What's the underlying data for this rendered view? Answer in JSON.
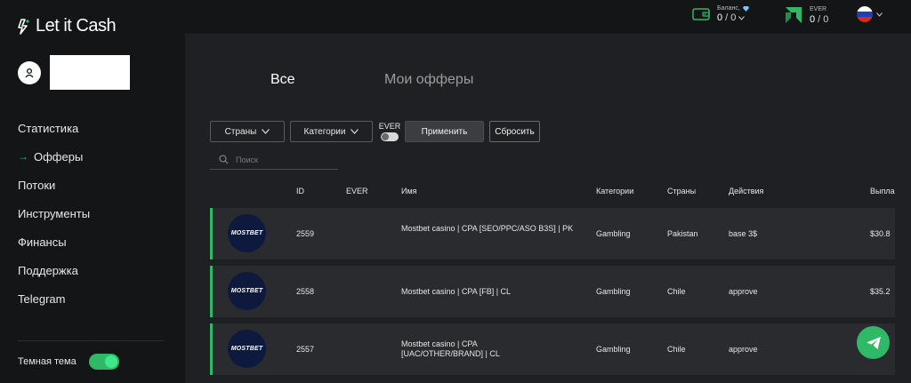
{
  "app": {
    "logo_text": "Let it Cash"
  },
  "sidebar": {
    "nav": [
      {
        "label": "Статистика",
        "active": false
      },
      {
        "label": "Офферы",
        "active": true
      },
      {
        "label": "Потоки",
        "active": false
      },
      {
        "label": "Инструменты",
        "active": false
      },
      {
        "label": "Финансы",
        "active": false
      },
      {
        "label": "Поддержка",
        "active": false
      },
      {
        "label": "Telegram",
        "active": false
      }
    ],
    "active_arrow": "→",
    "theme_label": "Темная тема",
    "theme_toggle_on": true
  },
  "topbar": {
    "balance_label": "Баланс,",
    "balance_value_primary": "0",
    "balance_value_secondary": "0",
    "balance_sep": " / ",
    "ever_label": "EVER",
    "ever_value_primary": "0",
    "ever_value_secondary": "0",
    "ever_sep": " / ",
    "language_icon": "russia-flag-icon",
    "accent_color": "#2fb866"
  },
  "tabs": [
    {
      "label": "Все",
      "active": true
    },
    {
      "label": "Мои офферы",
      "active": false
    }
  ],
  "filters": {
    "countries_label": "Страны",
    "categories_label": "Категории",
    "ever_label": "EVER",
    "ever_toggle_on": false,
    "apply_label": "Применить",
    "reset_label": "Сбросить",
    "search_placeholder": "Поиск"
  },
  "table": {
    "columns": {
      "id": "ID",
      "ever": "EVER",
      "name": "Имя",
      "category": "Категории",
      "country": "Страны",
      "action": "Действия",
      "payout": "Выпла"
    },
    "rows": [
      {
        "brand": "MOSTBET",
        "id": "2559",
        "ever": "",
        "name": "Mostbet casino | CPA [SEO/PPC/ASO B3S] | PK",
        "category": "Gambling",
        "country": "Pakistan",
        "action": "base 3$",
        "payout": "$30.8"
      },
      {
        "brand": "MOSTBET",
        "id": "2558",
        "ever": "",
        "name": "Mostbet casino | CPA [FB] | CL",
        "category": "Gambling",
        "country": "Chile",
        "action": "approve",
        "payout": "$35.2"
      },
      {
        "brand": "MOSTBET",
        "id": "2557",
        "ever": "",
        "name": "Mostbet casino | CPA [UAC/OTHER/BRAND] | CL",
        "category": "Gambling",
        "country": "Chile",
        "action": "approve",
        "payout": ""
      }
    ]
  },
  "fab_icon": "telegram-plane-icon"
}
